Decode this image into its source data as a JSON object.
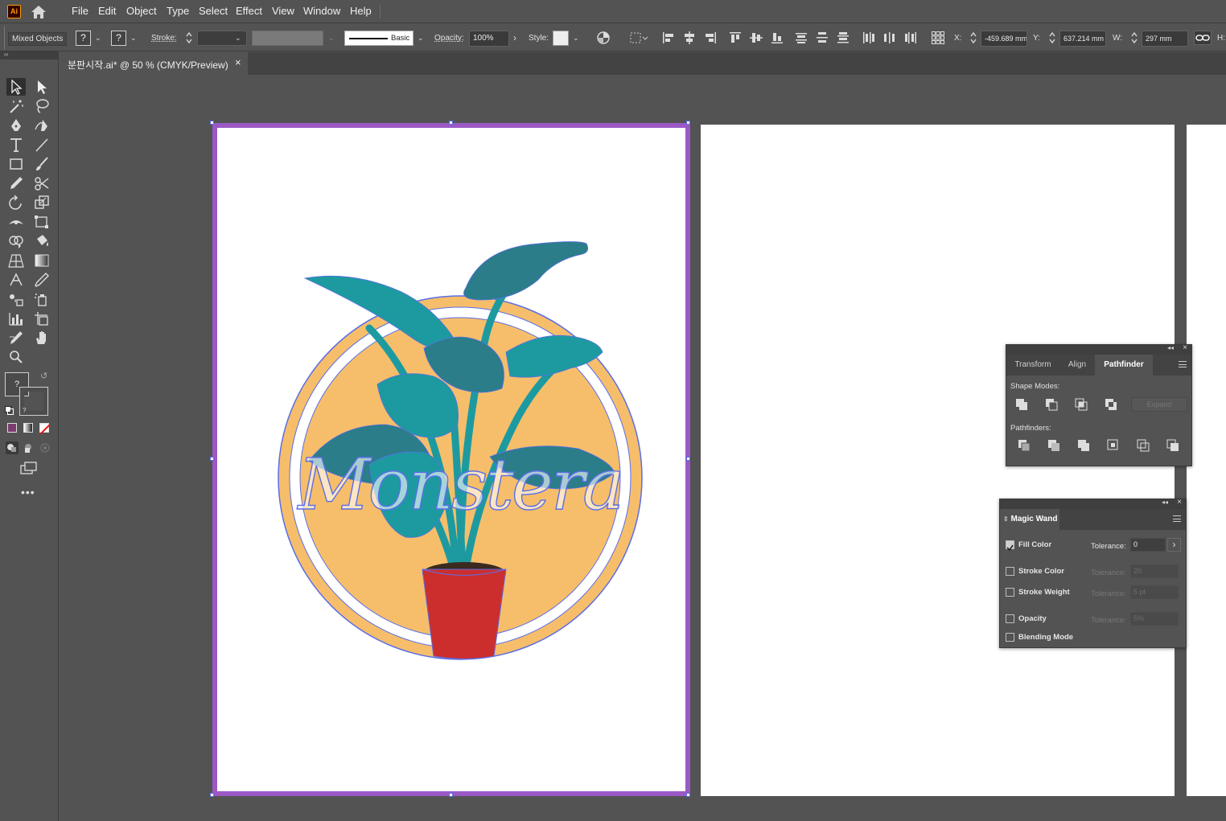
{
  "app": {
    "logo_text": "Ai"
  },
  "menu": [
    "File",
    "Edit",
    "Object",
    "Type",
    "Select",
    "Effect",
    "View",
    "Window",
    "Help"
  ],
  "control_bar": {
    "selection_type": "Mixed Objects",
    "fill_label": "?",
    "stroke_swatch_label": "?",
    "stroke_label": "Stroke:",
    "brush_label": "Basic",
    "opacity_label": "Opacity:",
    "opacity_value": "100%",
    "style_label": "Style:",
    "x_label": "X:",
    "x_value": "-459.689 mm",
    "y_label": "Y:",
    "y_value": "637.214 mm",
    "w_label": "W:",
    "w_value": "297 mm",
    "h_label": "H:"
  },
  "document_tab": {
    "title": "분판시작.ai* @ 50 % (CMYK/Preview)",
    "close_glyph": "×"
  },
  "artwork": {
    "text": "Monstera"
  },
  "pathfinder_panel": {
    "tabs": [
      "Transform",
      "Align",
      "Pathfinder"
    ],
    "active_tab": "Pathfinder",
    "shape_modes_label": "Shape Modes:",
    "pathfinders_label": "Pathfinders:",
    "expand_label": "Expand"
  },
  "magic_wand_panel": {
    "title": "Magic Wand",
    "rows": [
      {
        "label": "Fill Color",
        "checked": true,
        "tolerance_label": "Tolerance:",
        "tolerance_value": "0",
        "enabled": true
      },
      {
        "label": "Stroke Color",
        "checked": false,
        "tolerance_label": "Tolerance:",
        "tolerance_value": "20",
        "enabled": false
      },
      {
        "label": "Stroke Weight",
        "checked": false,
        "tolerance_label": "Tolerance:",
        "tolerance_value": "5 pt",
        "enabled": false
      },
      {
        "label": "Opacity",
        "checked": false,
        "tolerance_label": "Tolerance:",
        "tolerance_value": "5%",
        "enabled": false
      },
      {
        "label": "Blending Mode",
        "checked": false
      }
    ]
  },
  "colors": {
    "selection_purple": "#9b59c6",
    "orange_circle": "#f6be6a",
    "teal_leaf": "#1d9aa0",
    "dark_teal": "#2b7d8a",
    "pot_red": "#cc2e2e",
    "outline_blue": "#5b6ee8"
  }
}
